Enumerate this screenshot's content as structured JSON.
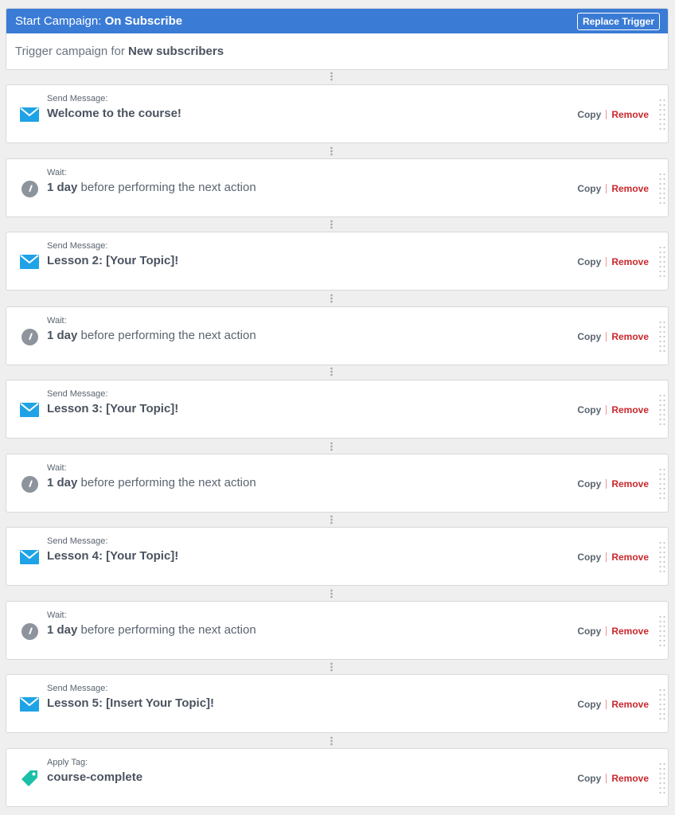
{
  "trigger": {
    "prefix": "Start Campaign:",
    "name": "On Subscribe",
    "replace_label": "Replace Trigger",
    "body_prefix": "Trigger campaign for",
    "body_target": "New subscribers"
  },
  "actions_labels": {
    "copy": "Copy",
    "remove": "Remove"
  },
  "steps": [
    {
      "type": "message",
      "kind": "Send Message:",
      "title": "Welcome to the course!"
    },
    {
      "type": "wait",
      "kind": "Wait:",
      "amount": "1 day",
      "rest": "before performing the next action"
    },
    {
      "type": "message",
      "kind": "Send Message:",
      "title": "Lesson 2: [Your Topic]!"
    },
    {
      "type": "wait",
      "kind": "Wait:",
      "amount": "1 day",
      "rest": "before performing the next action"
    },
    {
      "type": "message",
      "kind": "Send Message:",
      "title": "Lesson 3: [Your Topic]!"
    },
    {
      "type": "wait",
      "kind": "Wait:",
      "amount": "1 day",
      "rest": "before performing the next action"
    },
    {
      "type": "message",
      "kind": "Send Message:",
      "title": "Lesson 4: [Your Topic]!"
    },
    {
      "type": "wait",
      "kind": "Wait:",
      "amount": "1 day",
      "rest": "before performing the next action"
    },
    {
      "type": "message",
      "kind": "Send Message:",
      "title": "Lesson 5: [Insert Your Topic]!"
    },
    {
      "type": "tag",
      "kind": "Apply Tag:",
      "title": "course-complete"
    }
  ],
  "colors": {
    "header_blue": "#3a7bd5",
    "envelope": "#1fa3e6",
    "tag": "#1bbfa8",
    "clock": "#8d949c",
    "remove": "#c9282d"
  },
  "icons": {
    "message": "envelope-icon",
    "wait": "clock-icon",
    "tag": "tag-icon"
  }
}
